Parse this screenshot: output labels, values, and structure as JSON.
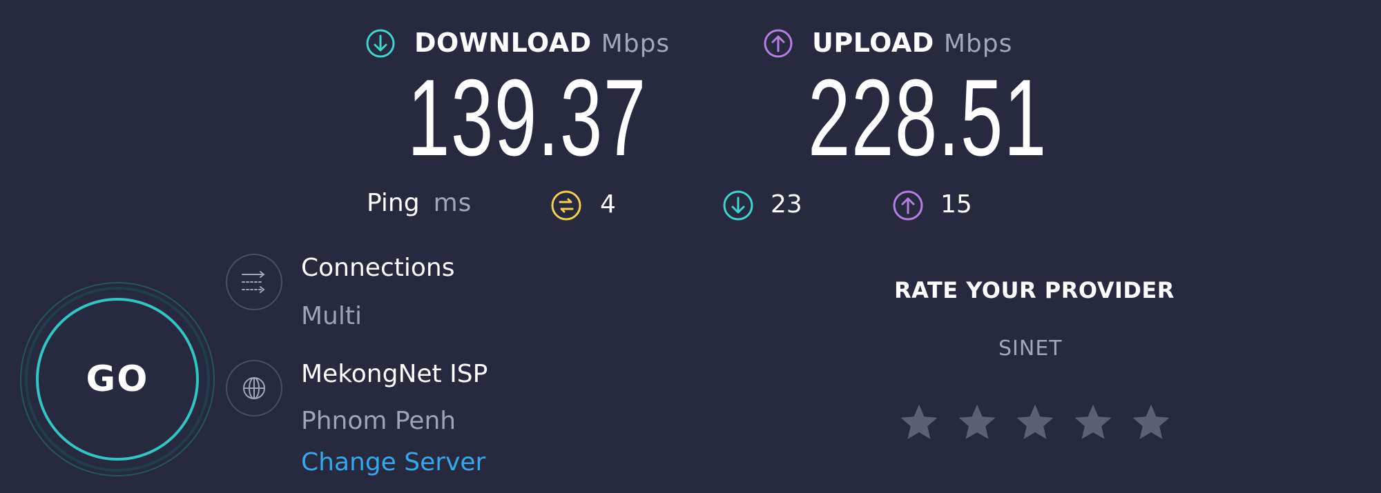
{
  "download": {
    "label": "DOWNLOAD",
    "unit": "Mbps",
    "value": "139.37",
    "icon": "download-arrow-icon",
    "color": "#3dd6cd"
  },
  "upload": {
    "label": "UPLOAD",
    "unit": "Mbps",
    "value": "228.51",
    "icon": "upload-arrow-icon",
    "color": "#b57ee4"
  },
  "ping": {
    "label": "Ping",
    "unit": "ms",
    "idle": {
      "value": "4",
      "icon": "ping-icon",
      "color": "#f3cf4e"
    },
    "download": {
      "value": "23",
      "icon": "download-arrow-icon",
      "color": "#3dd6cd"
    },
    "upload": {
      "value": "15",
      "icon": "upload-arrow-icon",
      "color": "#b57ee4"
    }
  },
  "go_button": {
    "label": "GO"
  },
  "connections": {
    "title": "Connections",
    "value": "Multi",
    "icon": "connections-icon"
  },
  "server": {
    "isp": "MekongNet ISP",
    "city": "Phnom Penh",
    "change_label": "Change Server",
    "icon": "globe-icon"
  },
  "rating": {
    "title": "RATE YOUR PROVIDER",
    "provider": "SINET",
    "stars": 5,
    "selected": 0
  }
}
